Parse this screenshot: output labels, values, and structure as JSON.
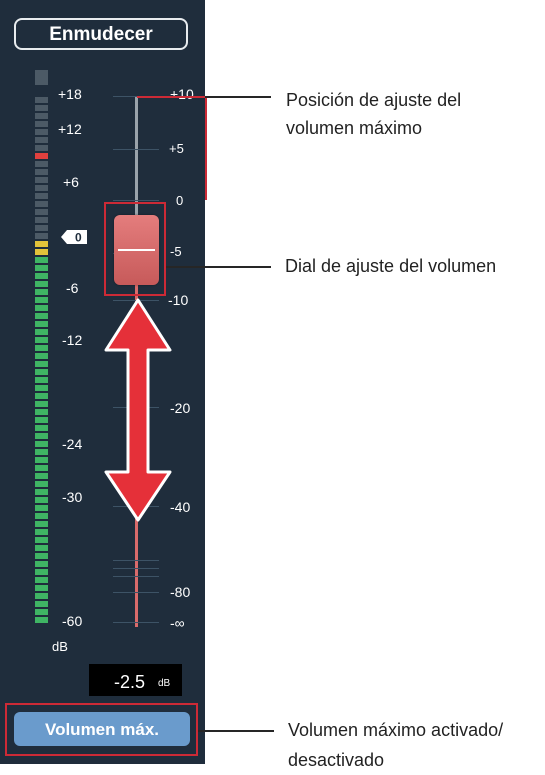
{
  "mute_button": {
    "label": "Enmudecer"
  },
  "meter": {
    "scale_labels": [
      "+18",
      "+12",
      "+6",
      "0",
      "-6",
      "-12",
      "-24",
      "-30",
      "-60"
    ],
    "unit": "dB",
    "colors": {
      "inactive": "#4c5a66",
      "peak": "#e0403e",
      "warn": "#e2c33a",
      "signal": "#3fb564"
    }
  },
  "fader": {
    "scale_labels": [
      "+10",
      "+5",
      "0",
      "-5",
      "-10",
      "-20",
      "-40",
      "-80",
      "-∞"
    ],
    "level_value": "-2.5",
    "level_unit": "dB",
    "knob_color": "#d96b6b",
    "range_arrow_color": "#e53039"
  },
  "max_volume_button": {
    "label": "Volumen máx.",
    "color": "#6a9bcc"
  },
  "callouts": {
    "max_position": "Posición de ajuste del volumen máximo",
    "volume_dial": "Dial de ajuste del volumen",
    "max_toggle": "Volumen máximo activado/ desactivado"
  },
  "highlight_color": "#cc2a36"
}
